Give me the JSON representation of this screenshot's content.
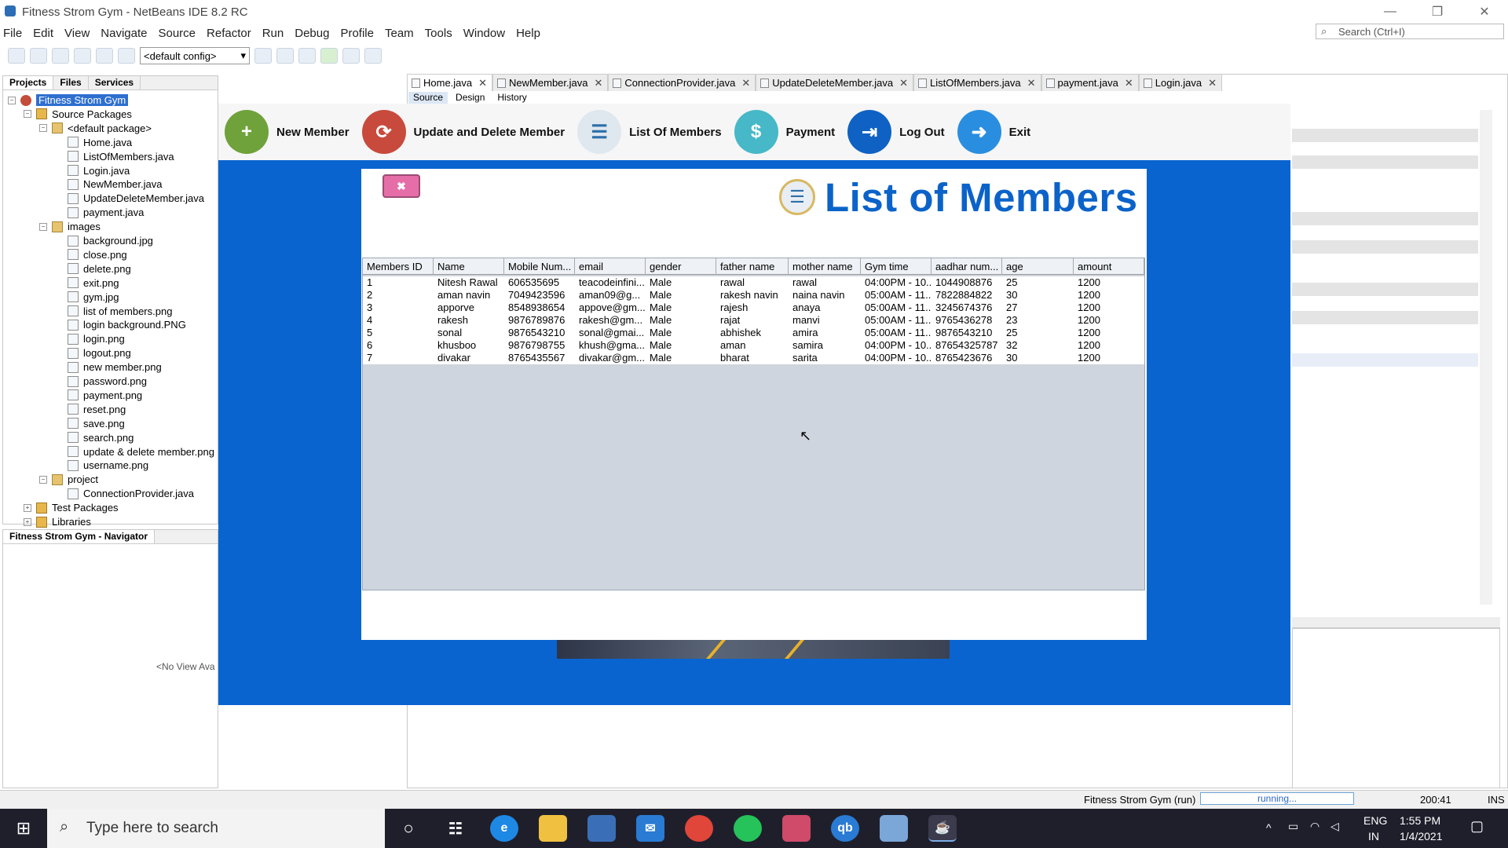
{
  "window": {
    "title": "Fitness Strom Gym - NetBeans IDE 8.2 RC",
    "minimize": "—",
    "restore": "❐",
    "close": "✕"
  },
  "menu": [
    "File",
    "Edit",
    "View",
    "Navigate",
    "Source",
    "Refactor",
    "Run",
    "Debug",
    "Profile",
    "Team",
    "Tools",
    "Window",
    "Help"
  ],
  "search": {
    "placeholder": "Search (Ctrl+I)"
  },
  "toolbar": {
    "config": "<default config>"
  },
  "projects": {
    "tabs": [
      "Projects",
      "Files",
      "Services"
    ],
    "tree": [
      {
        "label": "Fitness Strom Gym",
        "level": 0,
        "type": "proj",
        "exp": "−"
      },
      {
        "label": "Source Packages",
        "level": 1,
        "type": "folder",
        "exp": "−"
      },
      {
        "label": "<default package>",
        "level": 2,
        "type": "pkg",
        "exp": "−"
      },
      {
        "label": "Home.java",
        "level": 3,
        "type": "file"
      },
      {
        "label": "ListOfMembers.java",
        "level": 3,
        "type": "file"
      },
      {
        "label": "Login.java",
        "level": 3,
        "type": "file"
      },
      {
        "label": "NewMember.java",
        "level": 3,
        "type": "file"
      },
      {
        "label": "UpdateDeleteMember.java",
        "level": 3,
        "type": "file"
      },
      {
        "label": "payment.java",
        "level": 3,
        "type": "file"
      },
      {
        "label": "images",
        "level": 2,
        "type": "pkg",
        "exp": "−"
      },
      {
        "label": "background.jpg",
        "level": 3,
        "type": "file"
      },
      {
        "label": "close.png",
        "level": 3,
        "type": "file"
      },
      {
        "label": "delete.png",
        "level": 3,
        "type": "file"
      },
      {
        "label": "exit.png",
        "level": 3,
        "type": "file"
      },
      {
        "label": "gym.jpg",
        "level": 3,
        "type": "file"
      },
      {
        "label": "list of members.png",
        "level": 3,
        "type": "file"
      },
      {
        "label": "login background.PNG",
        "level": 3,
        "type": "file"
      },
      {
        "label": "login.png",
        "level": 3,
        "type": "file"
      },
      {
        "label": "logout.png",
        "level": 3,
        "type": "file"
      },
      {
        "label": "new member.png",
        "level": 3,
        "type": "file"
      },
      {
        "label": "password.png",
        "level": 3,
        "type": "file"
      },
      {
        "label": "payment.png",
        "level": 3,
        "type": "file"
      },
      {
        "label": "reset.png",
        "level": 3,
        "type": "file"
      },
      {
        "label": "save.png",
        "level": 3,
        "type": "file"
      },
      {
        "label": "search.png",
        "level": 3,
        "type": "file"
      },
      {
        "label": "update & delete member.png",
        "level": 3,
        "type": "file"
      },
      {
        "label": "username.png",
        "level": 3,
        "type": "file"
      },
      {
        "label": "project",
        "level": 2,
        "type": "pkg",
        "exp": "−"
      },
      {
        "label": "ConnectionProvider.java",
        "level": 3,
        "type": "file"
      },
      {
        "label": "Test Packages",
        "level": 1,
        "type": "folder",
        "exp": "+"
      },
      {
        "label": "Libraries",
        "level": 1,
        "type": "folder",
        "exp": "+"
      }
    ]
  },
  "navigator": {
    "tab": "Fitness Strom Gym - Navigator",
    "empty": "<No View Ava"
  },
  "editor": {
    "tabs": [
      "Home.java",
      "NewMember.java",
      "ConnectionProvider.java",
      "UpdateDeleteMember.java",
      "ListOfMembers.java",
      "payment.java",
      "Login.java"
    ],
    "subtabs": [
      "Source",
      "Design",
      "History"
    ]
  },
  "app": {
    "nav": [
      {
        "label": "New Member",
        "color": "#6fa23a",
        "glyph": "+"
      },
      {
        "label": "Update and Delete Member",
        "color": "#c84a3d",
        "glyph": "⟳"
      },
      {
        "label": "List Of Members",
        "color": "#dfe7ef",
        "glyph": "☰"
      },
      {
        "label": "Payment",
        "color": "#47b8c8",
        "glyph": "$"
      },
      {
        "label": "Log Out",
        "color": "#0f62c4",
        "glyph": "⇥"
      },
      {
        "label": "Exit",
        "color": "#2a8ee0",
        "glyph": "➜"
      }
    ],
    "close_glyph": "✖",
    "title": "List of Members",
    "columns": [
      "Members ID",
      "Name",
      "Mobile Num...",
      "email",
      "gender",
      "father name",
      "mother name",
      "Gym time",
      "aadhar num...",
      "age",
      "amount"
    ],
    "rows": [
      [
        "1",
        "Nitesh Rawal",
        "606535695",
        "teacodeinfini...",
        "Male",
        "rawal",
        "rawal",
        "04:00PM - 10...",
        "1044908876",
        "25",
        "1200"
      ],
      [
        "2",
        "aman navin",
        "7049423596",
        "aman09@g...",
        "Male",
        "rakesh navin",
        "naina navin",
        "05:00AM - 11...",
        "7822884822",
        "30",
        "1200"
      ],
      [
        "3",
        "apporve",
        "8548938654",
        "appove@gm...",
        "Male",
        "rajesh",
        "anaya",
        "05:00AM - 11...",
        "3245674376",
        "27",
        "1200"
      ],
      [
        "4",
        "rakesh",
        "9876789876",
        "rakesh@gm...",
        "Male",
        "rajat",
        "manvi",
        "05:00AM - 11...",
        "9765436278",
        "23",
        "1200"
      ],
      [
        "5",
        "sonal",
        "9876543210",
        "sonal@gmai...",
        "Male",
        "abhishek",
        "amira",
        "05:00AM - 11...",
        "9876543210",
        "25",
        "1200"
      ],
      [
        "6",
        "khusboo",
        "9876798755",
        "khush@gma...",
        "Male",
        "aman",
        "samira",
        "04:00PM - 10...",
        "87654325787",
        "32",
        "1200"
      ],
      [
        "7",
        "divakar",
        "8765435567",
        "divakar@gm...",
        "Male",
        "bharat",
        "sarita",
        "04:00PM - 10...",
        "8765423676",
        "30",
        "1200"
      ]
    ]
  },
  "status": {
    "project": "Fitness Strom Gym (run)",
    "progress": "running...",
    "position": "200:41",
    "mode": "INS"
  },
  "taskbar": {
    "search": "Type here to search",
    "lang1": "ENG",
    "lang2": "IN",
    "time": "1:55 PM",
    "date": "1/4/2021"
  }
}
